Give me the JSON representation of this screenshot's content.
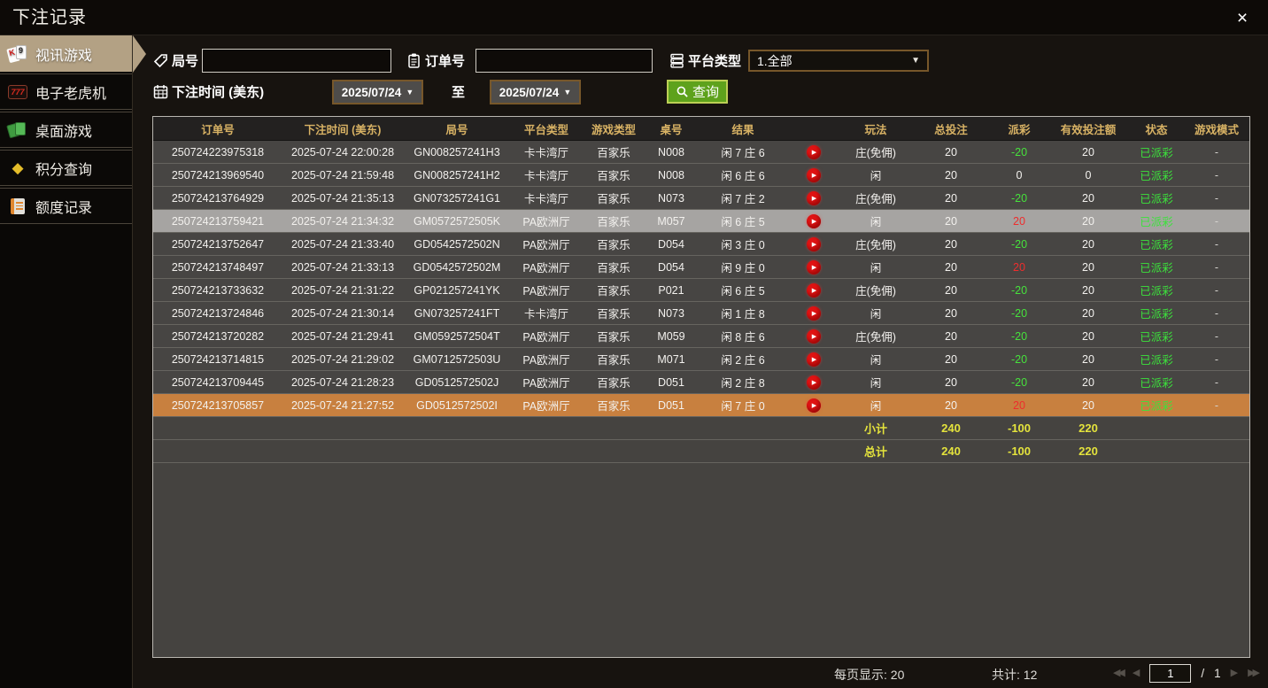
{
  "window": {
    "title": "下注记录",
    "close_label": "×"
  },
  "sidebar": {
    "items": [
      {
        "label": "视讯游戏"
      },
      {
        "label": "电子老虎机"
      },
      {
        "label": "桌面游戏"
      },
      {
        "label": "积分查询"
      },
      {
        "label": "额度记录"
      }
    ],
    "active_index": 0
  },
  "filters": {
    "round_label": "局号",
    "round_value": "",
    "order_label": "订单号",
    "order_value": "",
    "platform_label": "平台类型",
    "platform_value": "1.全部",
    "time_label": "下注时间 (美东)",
    "date_from": "2025/07/24",
    "to_label": "至",
    "date_to": "2025/07/24",
    "search_label": "查询"
  },
  "table": {
    "headers": [
      "订单号",
      "下注时间 (美东)",
      "局号",
      "平台类型",
      "游戏类型",
      "桌号",
      "结果",
      "",
      "玩法",
      "总投注",
      "派彩",
      "有效投注额",
      "状态",
      "游戏模式"
    ],
    "rows": [
      {
        "order_id": "250724223975318",
        "bet_time": "2025-07-24 22:00:28",
        "round_id": "GN008257241H3",
        "platform": "卡卡湾厅",
        "game_type": "百家乐",
        "table_no": "N008",
        "result": "闲 7 庄 6",
        "play": "庄(免佣)",
        "total_bet": "20",
        "payout": "-20",
        "payout_class": "neg",
        "valid_bet": "20",
        "status": "已派彩",
        "mode": "-",
        "highlight": ""
      },
      {
        "order_id": "250724213969540",
        "bet_time": "2025-07-24 21:59:48",
        "round_id": "GN008257241H2",
        "platform": "卡卡湾厅",
        "game_type": "百家乐",
        "table_no": "N008",
        "result": "闲 6 庄 6",
        "play": "闲",
        "total_bet": "20",
        "payout": "0",
        "payout_class": "zero",
        "valid_bet": "0",
        "status": "已派彩",
        "mode": "-",
        "highlight": ""
      },
      {
        "order_id": "250724213764929",
        "bet_time": "2025-07-24 21:35:13",
        "round_id": "GN073257241G1",
        "platform": "卡卡湾厅",
        "game_type": "百家乐",
        "table_no": "N073",
        "result": "闲 7 庄 2",
        "play": "庄(免佣)",
        "total_bet": "20",
        "payout": "-20",
        "payout_class": "neg",
        "valid_bet": "20",
        "status": "已派彩",
        "mode": "-",
        "highlight": ""
      },
      {
        "order_id": "250724213759421",
        "bet_time": "2025-07-24 21:34:32",
        "round_id": "GM0572572505K",
        "platform": "PA欧洲厅",
        "game_type": "百家乐",
        "table_no": "M057",
        "result": "闲 6 庄 5",
        "play": "闲",
        "total_bet": "20",
        "payout": "20",
        "payout_class": "pos",
        "valid_bet": "20",
        "status": "已派彩",
        "mode": "-",
        "highlight": "hl-gray"
      },
      {
        "order_id": "250724213752647",
        "bet_time": "2025-07-24 21:33:40",
        "round_id": "GD0542572502N",
        "platform": "PA欧洲厅",
        "game_type": "百家乐",
        "table_no": "D054",
        "result": "闲 3 庄 0",
        "play": "庄(免佣)",
        "total_bet": "20",
        "payout": "-20",
        "payout_class": "neg",
        "valid_bet": "20",
        "status": "已派彩",
        "mode": "-",
        "highlight": ""
      },
      {
        "order_id": "250724213748497",
        "bet_time": "2025-07-24 21:33:13",
        "round_id": "GD0542572502M",
        "platform": "PA欧洲厅",
        "game_type": "百家乐",
        "table_no": "D054",
        "result": "闲 9 庄 0",
        "play": "闲",
        "total_bet": "20",
        "payout": "20",
        "payout_class": "pos",
        "valid_bet": "20",
        "status": "已派彩",
        "mode": "-",
        "highlight": ""
      },
      {
        "order_id": "250724213733632",
        "bet_time": "2025-07-24 21:31:22",
        "round_id": "GP021257241YK",
        "platform": "PA欧洲厅",
        "game_type": "百家乐",
        "table_no": "P021",
        "result": "闲 6 庄 5",
        "play": "庄(免佣)",
        "total_bet": "20",
        "payout": "-20",
        "payout_class": "neg",
        "valid_bet": "20",
        "status": "已派彩",
        "mode": "-",
        "highlight": ""
      },
      {
        "order_id": "250724213724846",
        "bet_time": "2025-07-24 21:30:14",
        "round_id": "GN073257241FT",
        "platform": "卡卡湾厅",
        "game_type": "百家乐",
        "table_no": "N073",
        "result": "闲 1 庄 8",
        "play": "闲",
        "total_bet": "20",
        "payout": "-20",
        "payout_class": "neg",
        "valid_bet": "20",
        "status": "已派彩",
        "mode": "-",
        "highlight": ""
      },
      {
        "order_id": "250724213720282",
        "bet_time": "2025-07-24 21:29:41",
        "round_id": "GM0592572504T",
        "platform": "PA欧洲厅",
        "game_type": "百家乐",
        "table_no": "M059",
        "result": "闲 8 庄 6",
        "play": "庄(免佣)",
        "total_bet": "20",
        "payout": "-20",
        "payout_class": "neg",
        "valid_bet": "20",
        "status": "已派彩",
        "mode": "-",
        "highlight": ""
      },
      {
        "order_id": "250724213714815",
        "bet_time": "2025-07-24 21:29:02",
        "round_id": "GM0712572503U",
        "platform": "PA欧洲厅",
        "game_type": "百家乐",
        "table_no": "M071",
        "result": "闲 2 庄 6",
        "play": "闲",
        "total_bet": "20",
        "payout": "-20",
        "payout_class": "neg",
        "valid_bet": "20",
        "status": "已派彩",
        "mode": "-",
        "highlight": ""
      },
      {
        "order_id": "250724213709445",
        "bet_time": "2025-07-24 21:28:23",
        "round_id": "GD0512572502J",
        "platform": "PA欧洲厅",
        "game_type": "百家乐",
        "table_no": "D051",
        "result": "闲 2 庄 8",
        "play": "闲",
        "total_bet": "20",
        "payout": "-20",
        "payout_class": "neg",
        "valid_bet": "20",
        "status": "已派彩",
        "mode": "-",
        "highlight": ""
      },
      {
        "order_id": "250724213705857",
        "bet_time": "2025-07-24 21:27:52",
        "round_id": "GD0512572502I",
        "platform": "PA欧洲厅",
        "game_type": "百家乐",
        "table_no": "D051",
        "result": "闲 7 庄 0",
        "play": "闲",
        "total_bet": "20",
        "payout": "20",
        "payout_class": "pos",
        "valid_bet": "20",
        "status": "已派彩",
        "mode": "-",
        "highlight": "hl-orange"
      }
    ],
    "subtotal": {
      "label": "小计",
      "total_bet": "240",
      "payout": "-100",
      "valid_bet": "220"
    },
    "total": {
      "label": "总计",
      "total_bet": "240",
      "payout": "-100",
      "valid_bet": "220"
    }
  },
  "footer": {
    "page_size_label": "每页显示: 20",
    "record_count_label": "共计: 12",
    "page": "1",
    "page_separator": "/",
    "page_count": "1"
  },
  "colors": {
    "accent_gold": "#d8b264",
    "win_red": "#ee2d2d",
    "loss_green": "#46e23c",
    "status_green": "#3ce23c",
    "totals_yellow": "#e4e33c",
    "row_highlight_gray": "#a6a4a2",
    "row_highlight_orange": "#c8803f",
    "active_menu_tan": "#b3a184",
    "search_button_green": "#5ea21c"
  }
}
